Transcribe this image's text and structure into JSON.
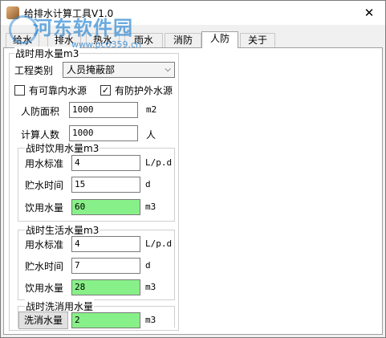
{
  "window": {
    "title": "给排水计算工具V1.0",
    "close": "✕"
  },
  "watermark": {
    "text": "河东软件园",
    "url": "www.pc0359.cn"
  },
  "tabs": [
    "给水",
    "排水",
    "热水",
    "雨水",
    "消防",
    "人防",
    "关于"
  ],
  "active_tab": "人防",
  "main": {
    "group_title": "战时用水量m3",
    "project_type_label": "工程类别",
    "project_type_value": "人员掩蔽部",
    "cb1_label": "有可靠内水源",
    "cb1_checked": false,
    "cb2_label": "有防护外水源",
    "cb2_checked": true,
    "area_label": "人防面积",
    "area_value": "1000",
    "area_unit": "m2",
    "people_label": "计算人数",
    "people_value": "1000",
    "people_unit": "人"
  },
  "drinking": {
    "title": "战时饮用水量m3",
    "std_label": "用水标准",
    "std_value": "4",
    "std_unit": "L/p.d",
    "storage_label": "贮水时间",
    "storage_value": "15",
    "storage_unit": "d",
    "volume_label": "饮用水量",
    "volume_value": "60",
    "volume_unit": "m3"
  },
  "living": {
    "title": "战时生活水量m3",
    "std_label": "用水标准",
    "std_value": "4",
    "std_unit": "L/p.d",
    "storage_label": "贮水时间",
    "storage_value": "7",
    "storage_unit": "d",
    "volume_label": "饮用水量",
    "volume_value": "28",
    "volume_unit": "m3"
  },
  "decon": {
    "title": "战时洗消用水量",
    "button_label": "洗消水量",
    "value": "2",
    "unit": "m3"
  },
  "colors": {
    "result_green": "#88f088",
    "watermark_blue": "#3a8fd6"
  }
}
